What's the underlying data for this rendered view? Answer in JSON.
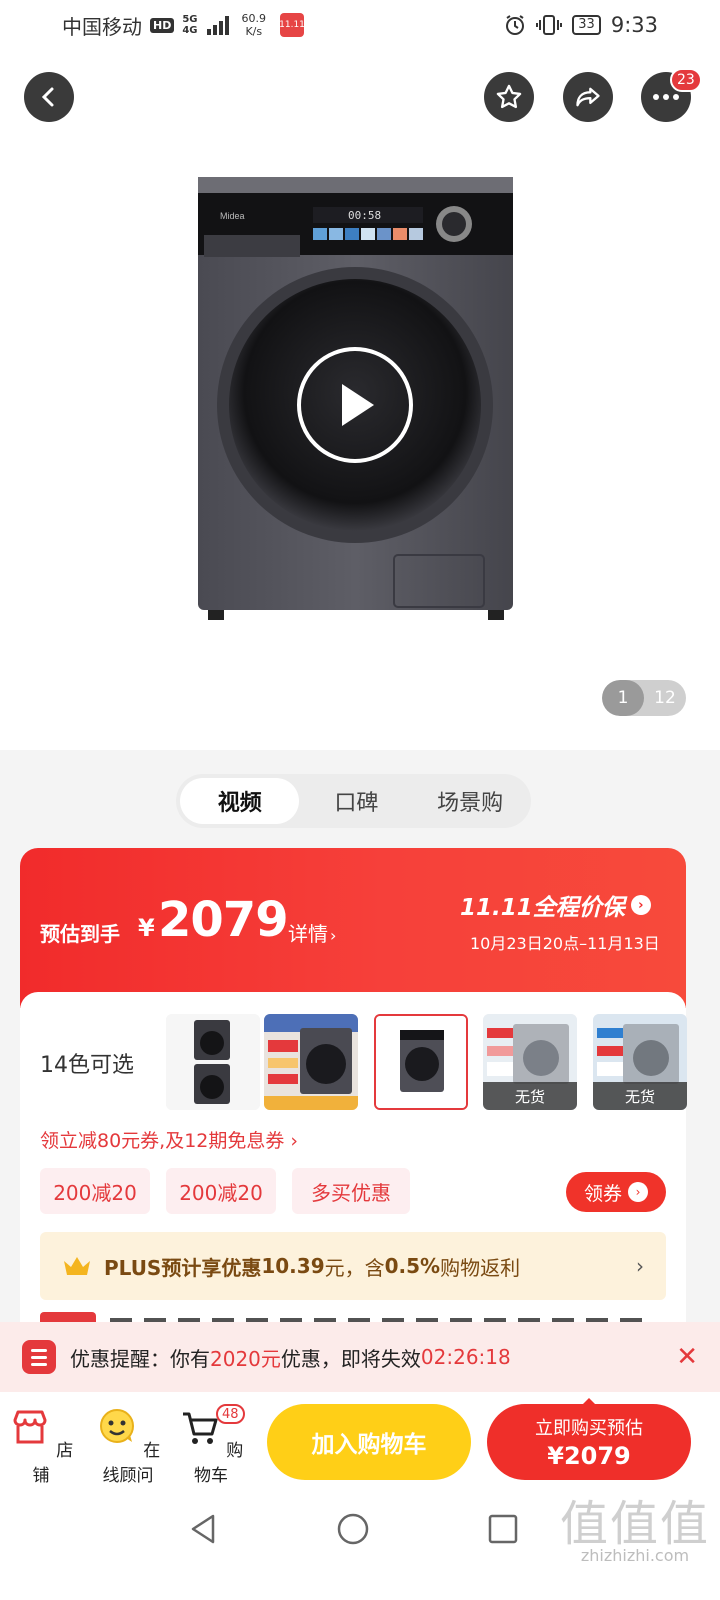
{
  "status_bar": {
    "carrier": "中国移动",
    "hd": "HD",
    "network": "5G",
    "signal_sub": "4G",
    "speed_value": "60.9",
    "speed_unit": "K/s",
    "battery": "33",
    "time": "9:33"
  },
  "header": {
    "more_badge": "23"
  },
  "gallery": {
    "current_page": "1",
    "total_pages": "12",
    "brand": "Midea",
    "display_readout": "00:58"
  },
  "media_tabs": [
    {
      "label": "视频",
      "active": true
    },
    {
      "label": "口碑",
      "active": false
    },
    {
      "label": "场景购",
      "active": false
    }
  ],
  "price_banner": {
    "label": "预估到手",
    "symbol": "¥",
    "price": "2079",
    "detail": "详情",
    "detail_arrow": "›",
    "promo_title": "11.11全程价保",
    "promo_arrow": "›",
    "promo_date": "10月23日20点–11月13日"
  },
  "variants": {
    "label": "14色可选",
    "out_of_stock_label": "无货",
    "thumbs": [
      {
        "name": "stacked-pair",
        "out_of_stock": false
      },
      {
        "name": "promo-poster",
        "out_of_stock": false
      },
      {
        "name": "dark-gray",
        "out_of_stock": false,
        "selected": true
      },
      {
        "name": "silver-poster",
        "out_of_stock": true
      },
      {
        "name": "blue-poster",
        "out_of_stock": true
      }
    ]
  },
  "coupons": {
    "line": "领立减80元券,及12期免息券 ›",
    "tags": [
      "200减20",
      "200减20",
      "多买优惠"
    ],
    "claim_label": "领券",
    "claim_arrow": "›"
  },
  "plus": {
    "prefix": "PLUS预计享优惠",
    "amount": "10.39",
    "mid": "元，含",
    "rate": "0.5%",
    "suffix": "购物返利",
    "chevron": "›"
  },
  "reminder": {
    "prefix": "优惠提醒：你有",
    "amount": "2020元",
    "middle": "优惠，即将失效",
    "countdown": "02:26:18",
    "close": "✕"
  },
  "action_bar": {
    "store": "店铺",
    "advisor": "在线顾问",
    "cart": "购物车",
    "cart_count": "48",
    "add_to_cart": "加入购物车",
    "buy_line1": "立即购买预估",
    "buy_line2": "¥2079"
  },
  "watermark": {
    "big": "值值值",
    "small": "zhizhizhi.com"
  },
  "colors": {
    "accent_red": "#e4393c",
    "banner_red": "#f12b2b",
    "cart_yellow": "#ffcf17",
    "plus_bg": "#fdf2dc"
  }
}
